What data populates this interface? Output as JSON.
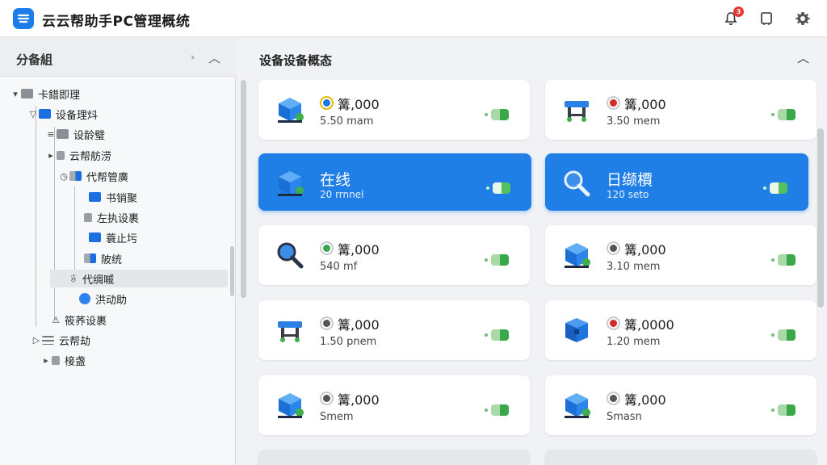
{
  "app": {
    "title": "云云帮助手PC管理概统",
    "notification_count": "3"
  },
  "icons": {
    "logo": "cloud-logo-icon",
    "bell": "bell-icon",
    "window": "window-icon",
    "settings": "gear-icon"
  },
  "colors": {
    "accent": "#1f7fe6",
    "toggle_on": "#38a84a",
    "badge": "#e53935"
  },
  "sidebar": {
    "title": "分备組",
    "tree": [
      {
        "label": "卡錯即理",
        "expander": "▾",
        "icon": "folder-gray"
      },
      {
        "label": "设备理炓",
        "expander": "▽",
        "icon": "folder-blue"
      },
      {
        "label": "设龄璧",
        "expander": "≡",
        "icon": "folder-gray"
      },
      {
        "label": "云帮舫涝",
        "expander": "▸",
        "icon": "small-gray"
      },
      {
        "label": "代帮管廣",
        "expander": "◷",
        "icon": "folder-half"
      },
      {
        "label": "书销聚",
        "expander": "",
        "icon": "folder-blue"
      },
      {
        "label": "左执设裹",
        "expander": "",
        "icon": "small-gray"
      },
      {
        "label": "蓑止圬",
        "expander": "",
        "icon": "folder-blue"
      },
      {
        "label": "陂统",
        "expander": "",
        "icon": "folder-half"
      },
      {
        "label": "代绸嘁",
        "expander": "𝔉",
        "icon": "none"
      },
      {
        "label": "洪动助",
        "expander": "",
        "icon": "round-blue"
      },
      {
        "label": "筱荞设裹",
        "expander": "⚠",
        "icon": "none"
      },
      {
        "label": "云帮劫",
        "expander": "▷",
        "icon": "lines"
      },
      {
        "label": "椄盏",
        "expander": "▸",
        "icon": "small-gray"
      }
    ]
  },
  "main": {
    "title": "设备设备概态",
    "cards": [
      {
        "primary": "篝,000",
        "secondary": "5.50 mam",
        "device": "cube",
        "status_color": "#1b78e0",
        "status_ring": "#e6b800",
        "active": false
      },
      {
        "primary": "篝,000",
        "secondary": "3.50 mem",
        "device": "bench",
        "status_color": "#d42a2a",
        "status_ring": "#c7cbd1",
        "active": false
      },
      {
        "primary": "在线",
        "secondary": "20 rrnnel",
        "device": "cube",
        "status_color": "",
        "status_ring": "",
        "active": true
      },
      {
        "primary": "日缬檟",
        "secondary": "120 seto",
        "device": "magnifier",
        "status_color": "",
        "status_ring": "",
        "active": true
      },
      {
        "primary": "篝,000",
        "secondary": "540 mf",
        "device": "magnifier",
        "status_color": "#3aa64a",
        "status_ring": "#c7cbd1",
        "active": false
      },
      {
        "primary": "篝,000",
        "secondary": "3.10 mem",
        "device": "cube",
        "status_color": "#555555",
        "status_ring": "#c7cbd1",
        "active": false
      },
      {
        "primary": "篝,000",
        "secondary": "1.50 pnem",
        "device": "bench",
        "status_color": "#555555",
        "status_ring": "#c7cbd1",
        "active": false
      },
      {
        "primary": "篝,0000",
        "secondary": "1.20 mem",
        "device": "box",
        "status_color": "#d42a2a",
        "status_ring": "#c7cbd1",
        "active": false
      },
      {
        "primary": "篝,000",
        "secondary": "Smem",
        "device": "cube",
        "status_color": "#555555",
        "status_ring": "#c7cbd1",
        "active": false
      },
      {
        "primary": "篝,000",
        "secondary": "Smasn",
        "device": "cube",
        "status_color": "#555555",
        "status_ring": "#c7cbd1",
        "active": false
      }
    ]
  }
}
